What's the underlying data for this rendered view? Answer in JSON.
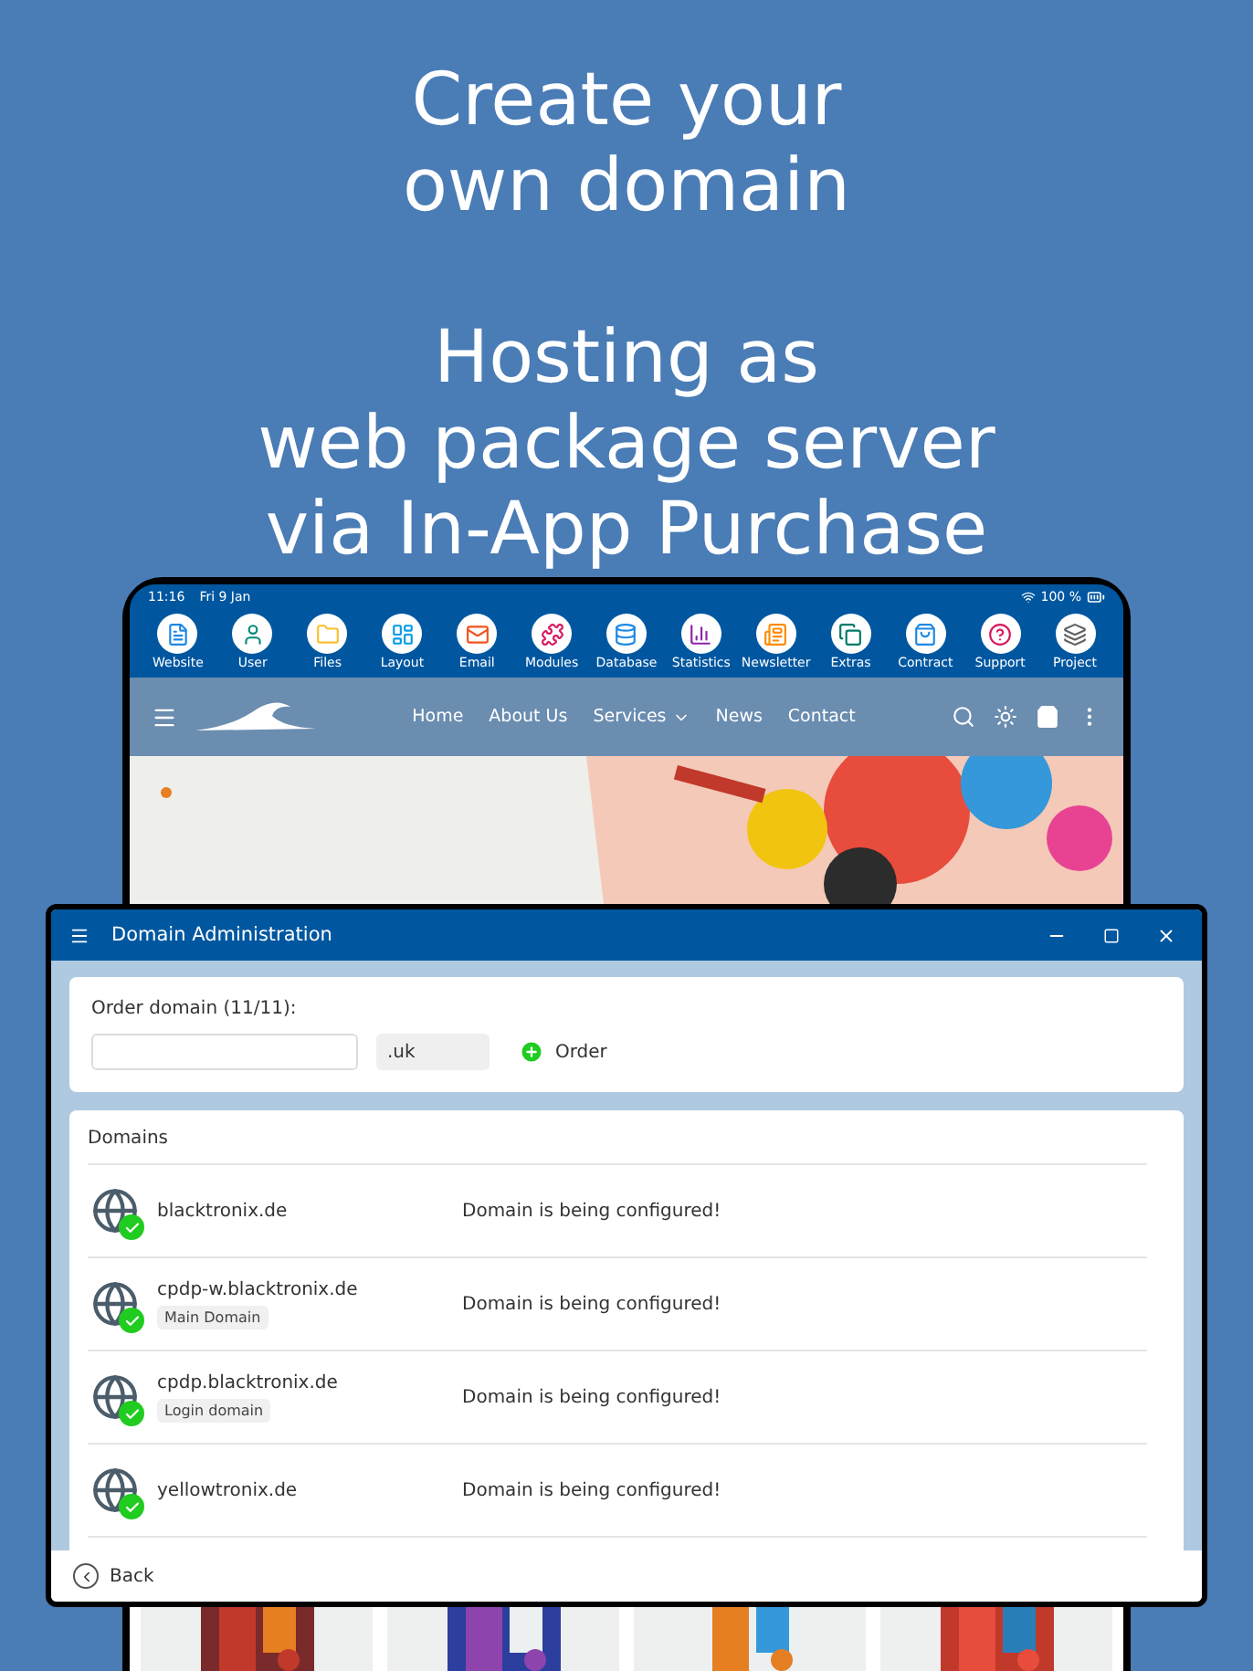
{
  "headline": [
    [
      "Create your",
      "own domain"
    ],
    [
      "Hosting as",
      "web package server",
      "via In-App Purchase"
    ]
  ],
  "tablet": {
    "status_bar": {
      "time": "11:16",
      "date": "Fri 9 Jan",
      "battery": "100 %"
    },
    "toolbar": [
      "Website",
      "User",
      "Files",
      "Layout",
      "Email",
      "Modules",
      "Database",
      "Statistics",
      "Newsletter",
      "Extras",
      "Contract",
      "Support",
      "Project"
    ],
    "nav": [
      "Home",
      "About Us",
      "Services",
      "News",
      "Contact"
    ]
  },
  "dialog": {
    "title": "Domain Administration",
    "order": {
      "label": "Order domain (11/11):",
      "tld": ".uk",
      "button": "Order"
    },
    "domains_title": "Domains",
    "domains": [
      {
        "name": "blacktronix.de",
        "status": "Domain is being configured!"
      },
      {
        "name": "cpdp-w.blacktronix.de",
        "tag": "Main Domain",
        "status": "Domain is being configured!"
      },
      {
        "name": "cpdp.blacktronix.de",
        "tag": "Login domain",
        "status": "Domain is being configured!"
      },
      {
        "name": "yellowtronix.de",
        "status": "Domain is being configured!"
      }
    ],
    "back": "Back"
  }
}
